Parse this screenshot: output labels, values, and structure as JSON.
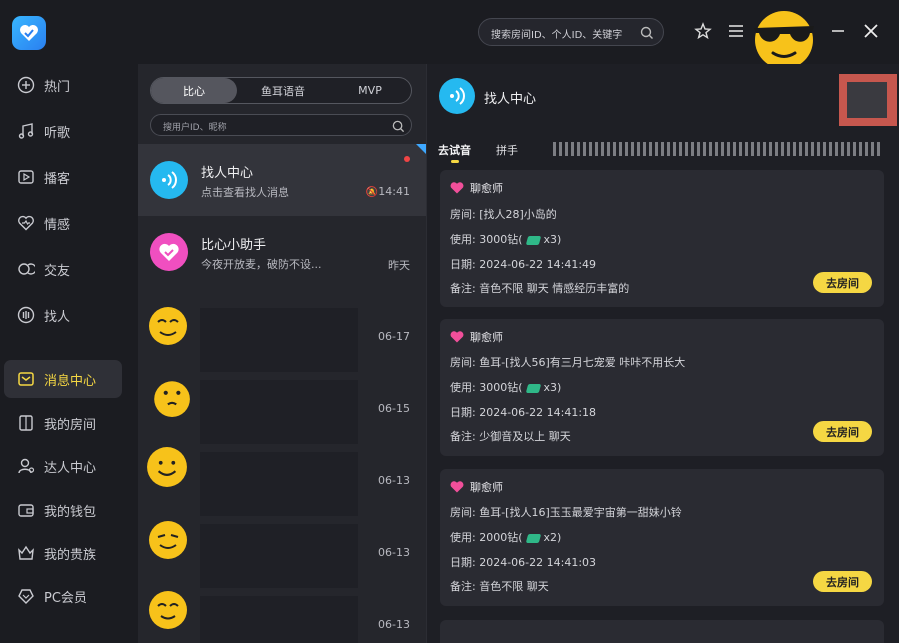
{
  "topbar": {
    "search_placeholder": "搜索房间ID、个人ID、关键字",
    "icons": [
      "search-icon",
      "star-icon",
      "menu-icon",
      "minimize-icon",
      "close-icon"
    ]
  },
  "sidebar": {
    "items": [
      {
        "label": "热门",
        "icon": "plus-circle-icon"
      },
      {
        "label": "听歌",
        "icon": "music-note-icon"
      },
      {
        "label": "播客",
        "icon": "podcast-icon"
      },
      {
        "label": "情感",
        "icon": "heart-pulse-icon"
      },
      {
        "label": "交友",
        "icon": "friends-icon"
      },
      {
        "label": "找人",
        "icon": "find-people-icon"
      },
      {
        "label": "消息中心",
        "icon": "message-center-icon",
        "active": true
      },
      {
        "label": "我的房间",
        "icon": "room-icon"
      },
      {
        "label": "达人中心",
        "icon": "expert-icon"
      },
      {
        "label": "我的钱包",
        "icon": "wallet-icon"
      },
      {
        "label": "我的贵族",
        "icon": "noble-icon"
      },
      {
        "label": "PC会员",
        "icon": "vip-icon"
      }
    ]
  },
  "chatlist": {
    "tabs": [
      "比心",
      "鱼耳语音",
      "MVP"
    ],
    "active_tab": "比心",
    "search_placeholder": "搜用户ID、昵称",
    "conversations": [
      {
        "name": "找人中心",
        "message": "点击查看找人消息",
        "time": "14:41"
      },
      {
        "name": "比心小助手",
        "message": "今夜开放麦，破防不设...",
        "time": "昨天"
      },
      {
        "name": "",
        "message": "",
        "time": "06-17"
      },
      {
        "name": "",
        "message": "",
        "time": "06-15"
      },
      {
        "name": "",
        "message": "",
        "time": "06-13"
      },
      {
        "name": "",
        "message": "",
        "time": "06-13"
      },
      {
        "name": "",
        "message": "",
        "time": "06-13"
      }
    ]
  },
  "detail": {
    "title": "找人中心",
    "tabs": [
      "去试音",
      "拼手"
    ],
    "join_label": "去房间",
    "cards": [
      {
        "role": "聊愈师",
        "room": "房间: [找人28]小岛的",
        "use_prefix": "使用: 3000钻(",
        "use_suffix": "x3)",
        "date": "日期: 2024-06-22 14:41:49",
        "note": "备注: 音色不限 聊天 情感经历丰富的"
      },
      {
        "role": "聊愈师",
        "room": "房间: 鱼耳-[找人56]有三月七宠爱 咔咔不用长大",
        "use_prefix": "使用: 3000钻(",
        "use_suffix": "x3)",
        "date": "日期: 2024-06-22 14:41:18",
        "note": "备注: 少御音及以上 聊天"
      },
      {
        "role": "聊愈师",
        "room": "房间: 鱼耳-[找人16]玉玉最爱宇宙第一甜妹小铃",
        "use_prefix": "使用: 2000钻(",
        "use_suffix": "x2)",
        "date": "日期: 2024-06-22 14:41:03",
        "note": "备注: 音色不限 聊天"
      }
    ]
  },
  "colors": {
    "accent": "#f5d743",
    "brand_blue": "#25b9f0",
    "assistant_pink": "#f04fc0"
  }
}
